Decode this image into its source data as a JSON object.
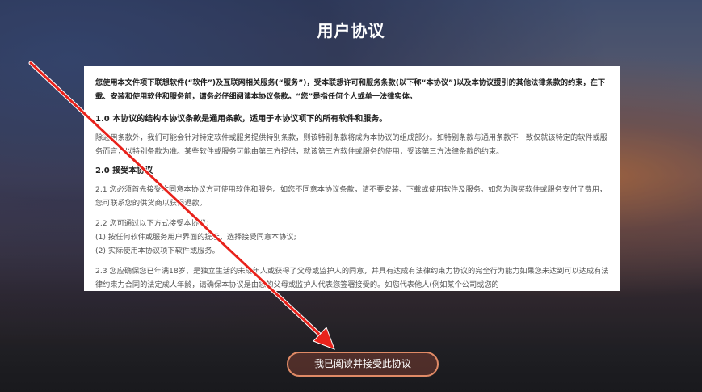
{
  "page": {
    "title": "用户协议"
  },
  "agreement": {
    "intro": "您使用本文件项下联想软件(“软件”)及互联网相关服务(“服务”)，受本联想许可和服务条款(以下称“本协议”)以及本协议援引的其他法律条款的约束，在下载、安装和使用软件和服务前，请务必仔细阅读本协议条款。“您”是指任何个人或单一法律实体。",
    "section1": {
      "heading": "1.0 本协议的结构本协议条款是通用条款，适用于本协议项下的所有软件和服务。",
      "body": "除通用条款外，我们可能会针对特定软件或服务提供特别条款，则该特别条款将成为本协议的组成部分。如特别条款与通用条款不一致仅就该特定的软件或服务而言，以特别条款为准。某些软件或服务可能由第三方提供，就该第三方软件或服务的使用，受该第三方法律条款的约束。"
    },
    "section2": {
      "heading": "2.0 接受本协议",
      "p1": "2.1 您必须首先接受本同意本协议方可使用软件和服务。如您不同意本协议条款，请不要安装、下载或使用软件及服务。如您为购买软件或服务支付了费用，您可联系您的供货商以获得退款。",
      "p2_line1": "2.2 您可通过以下方式接受本协议：",
      "p2_line2": "(1) 按任何软件或服务用户界面的提示，选择接受同意本协议;",
      "p2_line3": "(2) 实际使用本协议项下软件或服务。",
      "p3": "2.3 您应确保您已年满18岁、是独立生活的未成年人或获得了父母或监护人的同意，并具有达成有法律约束力协议的完全行为能力如果您未达到可以达成有法律约束力合同的法定成人年龄，请确保本协议是由您的父母或监护人代表您签署接受的。如您代表他人(例如某个公司或您的"
    }
  },
  "actions": {
    "accept_label": "我已阅读并接受此协议"
  },
  "colors": {
    "accent": "#e08a66",
    "arrow": "#e8221b"
  }
}
